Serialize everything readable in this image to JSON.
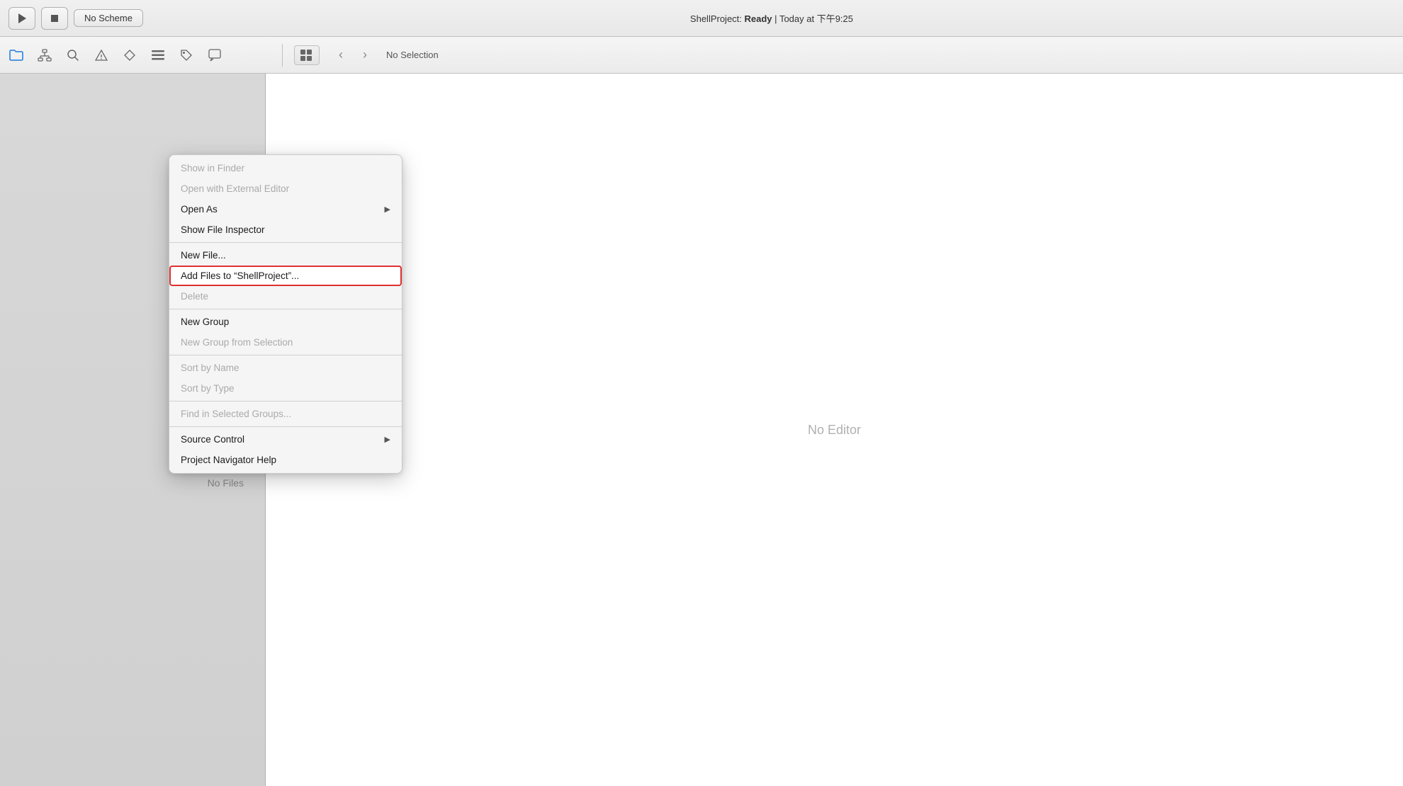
{
  "titlebar": {
    "play_label": "▶",
    "stop_label": "■",
    "scheme_label": "No Scheme",
    "status": "ShellProject: Ready",
    "divider": "|",
    "time": "Today at 下午9:25"
  },
  "toolbar": {
    "navigator_icon": "folder",
    "breadcrumb": "No Selection",
    "editor_mode_icon": "grid"
  },
  "sidebar": {
    "no_files_label": "No Files"
  },
  "editor": {
    "no_editor_label": "No Editor"
  },
  "context_menu": {
    "items": [
      {
        "id": "show-in-finder",
        "label": "Show in Finder",
        "disabled": true,
        "submenu": false,
        "highlighted": false
      },
      {
        "id": "open-external-editor",
        "label": "Open with External Editor",
        "disabled": true,
        "submenu": false,
        "highlighted": false
      },
      {
        "id": "open-as",
        "label": "Open As",
        "disabled": false,
        "submenu": true,
        "highlighted": false
      },
      {
        "id": "show-file-inspector",
        "label": "Show File Inspector",
        "disabled": false,
        "submenu": false,
        "highlighted": false
      },
      {
        "separator": true
      },
      {
        "id": "new-file",
        "label": "New File...",
        "disabled": false,
        "submenu": false,
        "highlighted": false
      },
      {
        "id": "add-files",
        "label": "Add Files to “ShellProject”...",
        "disabled": false,
        "submenu": false,
        "highlighted": true
      },
      {
        "id": "delete",
        "label": "Delete",
        "disabled": true,
        "submenu": false,
        "highlighted": false
      },
      {
        "separator": true
      },
      {
        "id": "new-group",
        "label": "New Group",
        "disabled": false,
        "submenu": false,
        "highlighted": false
      },
      {
        "id": "new-group-from-selection",
        "label": "New Group from Selection",
        "disabled": true,
        "submenu": false,
        "highlighted": false
      },
      {
        "separator": true
      },
      {
        "id": "sort-by-name",
        "label": "Sort by Name",
        "disabled": true,
        "submenu": false,
        "highlighted": false
      },
      {
        "id": "sort-by-type",
        "label": "Sort by Type",
        "disabled": true,
        "submenu": false,
        "highlighted": false
      },
      {
        "separator": true
      },
      {
        "id": "find-in-selected-groups",
        "label": "Find in Selected Groups...",
        "disabled": true,
        "submenu": false,
        "highlighted": false
      },
      {
        "separator": true
      },
      {
        "id": "source-control",
        "label": "Source Control",
        "disabled": false,
        "submenu": true,
        "highlighted": false
      },
      {
        "id": "project-navigator-help",
        "label": "Project Navigator Help",
        "disabled": false,
        "submenu": false,
        "highlighted": false
      }
    ]
  }
}
